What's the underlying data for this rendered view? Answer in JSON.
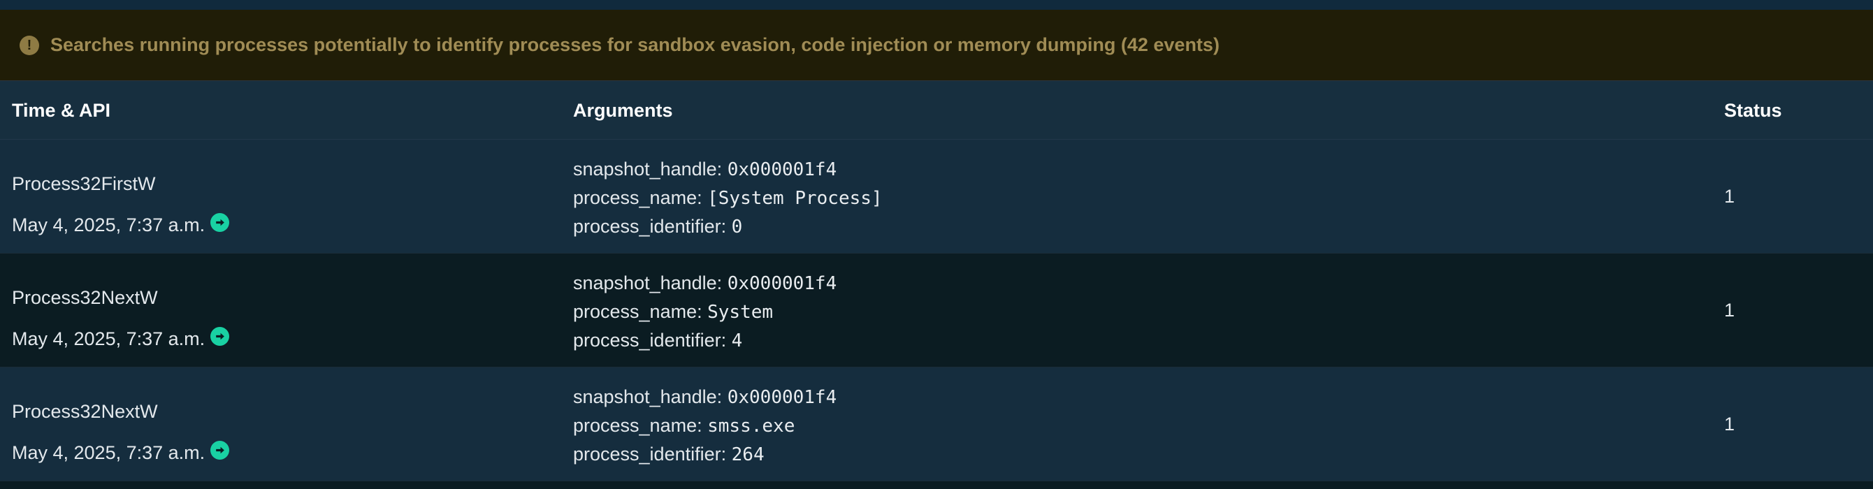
{
  "alert": {
    "icon": "exclamation-circle-icon",
    "text": "Searches running processes potentially to identify processes for sandbox evasion, code injection or memory dumping (42 events)",
    "color": "#a08c55"
  },
  "table": {
    "columns": {
      "time_api": "Time & API",
      "arguments": "Arguments",
      "status": "Status"
    },
    "rows": [
      {
        "api": "Process32FirstW",
        "time": "May 4, 2025, 7:37 a.m.",
        "args": [
          {
            "key": "snapshot_handle:",
            "value": "0x000001f4"
          },
          {
            "key": "process_name:",
            "value": "[System Process]"
          },
          {
            "key": "process_identifier:",
            "value": "0"
          }
        ],
        "status": "1"
      },
      {
        "api": "Process32NextW",
        "time": "May 4, 2025, 7:37 a.m.",
        "args": [
          {
            "key": "snapshot_handle:",
            "value": "0x000001f4"
          },
          {
            "key": "process_name:",
            "value": "System"
          },
          {
            "key": "process_identifier:",
            "value": "4"
          }
        ],
        "status": "1"
      },
      {
        "api": "Process32NextW",
        "time": "May 4, 2025, 7:37 a.m.",
        "args": [
          {
            "key": "snapshot_handle:",
            "value": "0x000001f4"
          },
          {
            "key": "process_name:",
            "value": "smss.exe"
          },
          {
            "key": "process_identifier:",
            "value": "264"
          }
        ],
        "status": "1"
      }
    ]
  },
  "colors": {
    "accent": "#19d1a3",
    "background": "#0f1f2a",
    "header_bg": "#172f3f",
    "row_odd": "#152d3e",
    "row_even": "#0b1c22"
  }
}
